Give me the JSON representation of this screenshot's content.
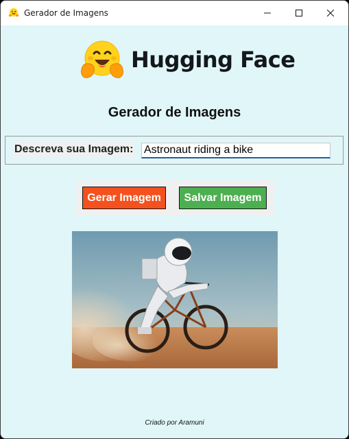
{
  "window": {
    "title": "Gerador de Imagens",
    "icon": "hugging-face-emoji-icon"
  },
  "logo": {
    "text": "Hugging Face",
    "icon": "hugging-face-emoji-icon"
  },
  "heading": "Gerador de Imagens",
  "prompt": {
    "label": "Descreva sua Imagem:",
    "value": "Astronaut riding a bike"
  },
  "buttons": {
    "generate_label": "Gerar Imagem",
    "save_label": "Salvar Imagem"
  },
  "image": {
    "description_icon": "astronaut-riding-bike-image"
  },
  "footer": "Criado por Aramuni",
  "colors": {
    "background": "#e0f6f8",
    "generate_button": "#f4511e",
    "save_button": "#4caf50",
    "input_underline": "#1f5f9f"
  }
}
